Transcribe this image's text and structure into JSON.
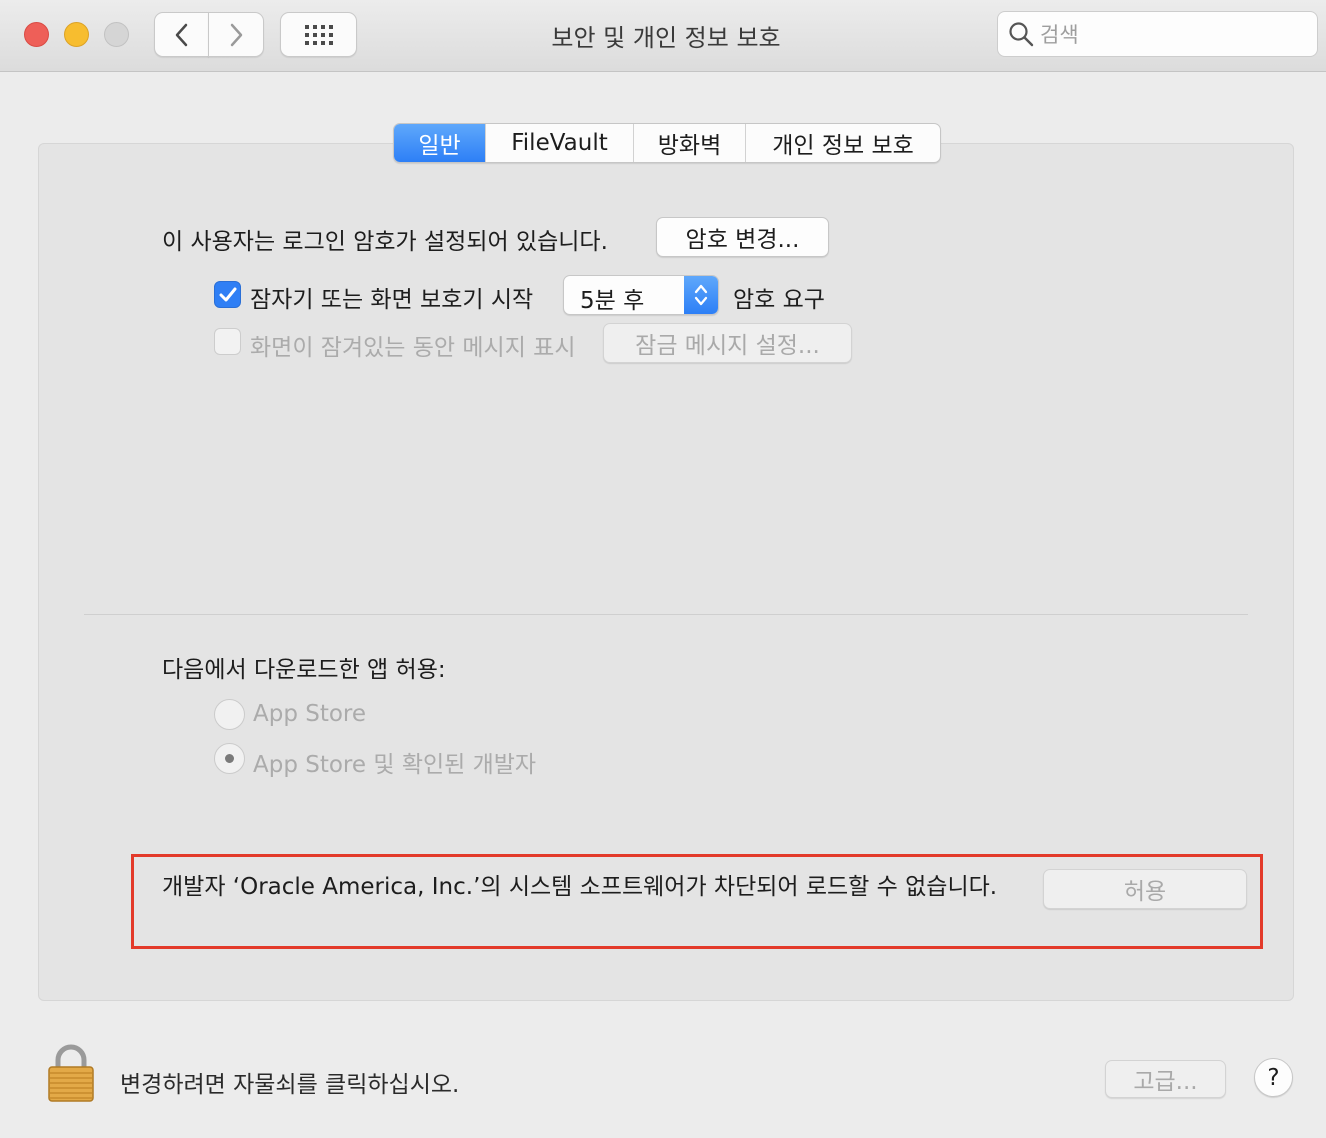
{
  "window": {
    "title": "보안 및 개인 정보 보호",
    "search_placeholder": "검색"
  },
  "tabs": [
    {
      "label": "일반",
      "active": true
    },
    {
      "label": "FileVault",
      "active": false
    },
    {
      "label": "방화벽",
      "active": false
    },
    {
      "label": "개인 정보 보호",
      "active": false
    }
  ],
  "general": {
    "password_text": "이 사용자는 로그인 암호가 설정되어 있습니다.",
    "change_password_button": "암호 변경...",
    "sleep_checkbox": {
      "label": "잠자기 또는 화면 보호기 시작",
      "checked": true
    },
    "delay_select": {
      "value": "5분 후"
    },
    "require_password_text": "암호 요구",
    "lock_message_checkbox": {
      "label": "화면이 잠겨있는 동안 메시지 표시",
      "checked": false,
      "disabled": true
    },
    "lock_message_button": "잠금 메시지 설정..."
  },
  "downloads": {
    "heading": "다음에서 다운로드한 앱 허용:",
    "options": [
      {
        "label": "App Store",
        "selected": false
      },
      {
        "label": "App Store 및 확인된 개발자",
        "selected": true
      }
    ]
  },
  "blocked": {
    "message": "개발자 ‘Oracle America, Inc.’의 시스템 소프트웨어가 차단되어 로드할 수 없습니다.",
    "allow_button": "허용"
  },
  "footer": {
    "lock_text": "변경하려면 자물쇠를 클릭하십시오.",
    "advanced_button": "고급...",
    "help_button": "?"
  },
  "colors": {
    "accent": "#2f7ff5",
    "highlight_border": "#e33a2a"
  }
}
